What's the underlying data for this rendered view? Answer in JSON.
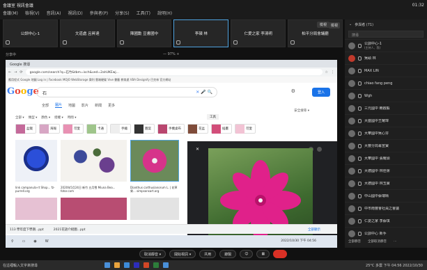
{
  "app": {
    "title": "會議室 視訊會議",
    "menu": [
      "會議(M)",
      "檢視(V)",
      "音訊(A)",
      "視訊(D)",
      "參與者(P)",
      "分享(S)",
      "工具(T)",
      "說明(H)"
    ],
    "clock": "01:32"
  },
  "tiles": [
    {
      "name": "公訓中心-1",
      "active": false
    },
    {
      "name": "文道處 呂昇達",
      "active": false
    },
    {
      "name": "陳國勳 豆書國中",
      "active": false
    },
    {
      "name": "李碩 林",
      "active": true
    },
    {
      "name": "仁愛之家 李清明",
      "active": false
    },
    {
      "name": "柏平分局會議廳",
      "active": false
    }
  ],
  "tile_button": "檢視",
  "subbar": {
    "left": "分享中",
    "middle": "— 97% +"
  },
  "browser": {
    "tab": "Google 搜尋",
    "url": "google.com/search?q=石竹&tbm=isch&ved=2ahUKEwj...",
    "bookmarks": "應用程式  Google 地圖  Log in | Facebook  MOJO WebStorage  樂利  雲端硬碟  Vive  書籤  教育處  VBA  Designify  巴克林 官方網站",
    "logo": [
      "G",
      "o",
      "o",
      "g",
      "l",
      "e"
    ],
    "query": "石",
    "signin": "登入",
    "tabs": [
      "全部",
      "圖片",
      "地圖",
      "影片",
      "新聞",
      "更多"
    ],
    "tools": "工具",
    "safe_search": "安全搜尋 ▾",
    "filters": [
      "全部 ▾",
      "類型 ▾",
      "顏色 ▾",
      "授權 ▾",
      "時間 ▾"
    ],
    "chips": [
      "盆栽",
      "海報",
      "可愛",
      "卡通",
      "手繪",
      "圖案",
      "手機桌布",
      "花盆",
      "插畫",
      "可愛",
      "花色"
    ],
    "captions": [
      "link campanula-rt Shop...\nfz-purrell.org",
      "2020年5月24日 新竹 五月雪 Miuna Bea...\nfotor.com",
      "Dianthus carthusianorum L. | 花草果...\nsimpsonsart.org"
    ],
    "downloads": [
      "113 學年度下學期...ppt",
      "2021花語介紹圖...ppt"
    ],
    "downloads_more": "全部顯示",
    "tray_text": "2022/10/30 下午 04:56"
  },
  "panel": {
    "header": "參與者 (71)",
    "expand_btn": "檢視",
    "search_placeholder": "搜尋",
    "participants": [
      {
        "name": "公訓中心-1",
        "sub": "(主持人、我)"
      },
      {
        "name": "吳碩 林",
        "sub": ""
      },
      {
        "name": "MAX LIN",
        "sub": ""
      },
      {
        "name": "chiao fang peng",
        "sub": ""
      },
      {
        "name": "Wgh",
        "sub": ""
      },
      {
        "name": "三元國中 賴啟毅",
        "sub": ""
      },
      {
        "name": "大盛國中王耀瑋",
        "sub": ""
      },
      {
        "name": "大華國中吳心芬",
        "sub": ""
      },
      {
        "name": "大豐分局幕宣寶",
        "sub": ""
      },
      {
        "name": "大華國中 張耀頭",
        "sub": ""
      },
      {
        "name": "大德國中 林佳霈",
        "sub": ""
      },
      {
        "name": "大德國中 林玉寶",
        "sub": ""
      },
      {
        "name": "中山國中蔡瑞晴",
        "sub": ""
      },
      {
        "name": "中市南豐會社員之會議",
        "sub": ""
      },
      {
        "name": "仁愛之家 李蔡琪",
        "sub": ""
      },
      {
        "name": "公訓中心 新手",
        "sub": ""
      }
    ],
    "footer": [
      "全部靜音",
      "全部取消靜音",
      "…"
    ]
  },
  "controls": [
    "取消靜音 ▾",
    "開始視訊 ▾",
    "共用",
    "錄製",
    "",
    ""
  ],
  "taskbar": {
    "search": "在這裡輸入文字來搜尋",
    "tray": "25°C 多雲  下午 04:56  2022/10/30"
  }
}
